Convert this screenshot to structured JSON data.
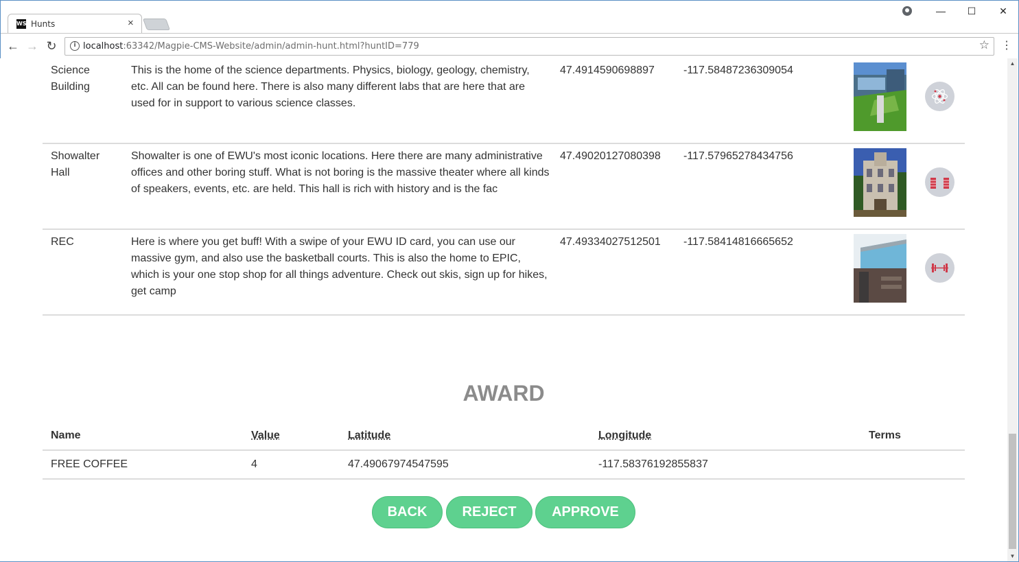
{
  "browser": {
    "tab_title": "Hunts",
    "tab_favicon": "WS",
    "url_host": "localhost",
    "url_rest": ":63342/Magpie-CMS-Website/admin/admin-hunt.html?huntID=779"
  },
  "locations": [
    {
      "name": "Science Building",
      "description": "This is the home of the science departments. Physics, biology, geology, chemistry, etc. All can be found here. There is also many different labs that are here that are used for in support to various science classes.",
      "latitude": "47.4914590698897",
      "longitude": "-117.58487236309054",
      "icon": "atom-icon",
      "photo_colors": [
        "#3f7cc0",
        "#4f9a2c"
      ]
    },
    {
      "name": "Showalter Hall",
      "description": "Showalter is one of EWU's most iconic locations. Here there are many administrative offices and other boring stuff. What is not boring is the massive theater where all kinds of speakers, events, etc. are held. This hall is rich with history and is the fac",
      "latitude": "47.49020127080398",
      "longitude": "-117.57965278434756",
      "icon": "theater-curtains-icon",
      "photo_colors": [
        "#3a5eb0",
        "#6a5a3a"
      ]
    },
    {
      "name": "REC",
      "description": "Here is where you get buff! With a swipe of your EWU ID card, you can use our massive gym, and also use the basketball courts. This is also the home to EPIC, which is your one stop shop for all things adventure. Check out skis, sign up for hikes, get camp",
      "latitude": "47.49334027512501",
      "longitude": "-117.58414816665652",
      "icon": "dumbbell-icon",
      "photo_colors": [
        "#6fb6d8",
        "#5b4a44"
      ]
    }
  ],
  "award": {
    "title": "AWARD",
    "headers": {
      "name": "Name",
      "value": "Value",
      "latitude": "Latitude",
      "longitude": "Longitude",
      "terms": "Terms"
    },
    "row": {
      "name": "FREE COFFEE",
      "value": "4",
      "latitude": "47.49067974547595",
      "longitude": "-117.58376192855837",
      "terms": ""
    }
  },
  "buttons": {
    "back": "BACK",
    "reject": "REJECT",
    "approve": "APPROVE"
  },
  "colors": {
    "button_bg": "#5ed18f",
    "icon_circle": "#cfd2d9",
    "icon_red": "#d03a4a",
    "award_title": "#8b8b8b"
  }
}
